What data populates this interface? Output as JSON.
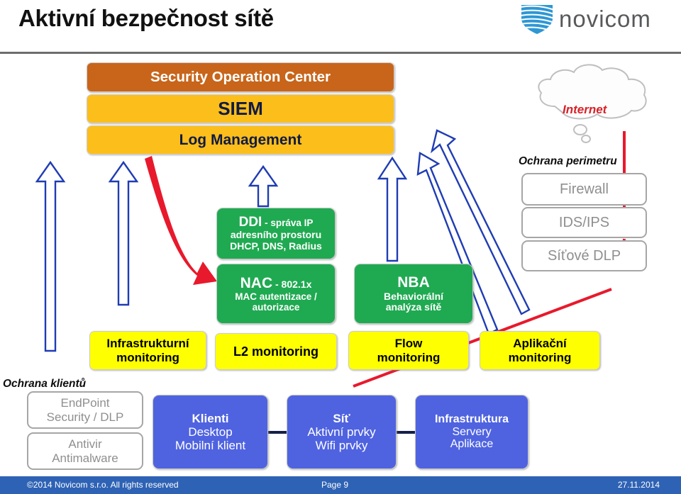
{
  "slide": {
    "title": "Aktivní bezpečnost sítě",
    "brand": {
      "wordmark": "novicom",
      "logo_icon": "shield-icon",
      "shield_color": "#2e97d4",
      "text_color": "#58595b"
    }
  },
  "colors": {
    "soc_header": "#c8651a",
    "soc_row": "#fcbe1a",
    "product_green": "#1faa51",
    "monitoring_yellow": "#feff00",
    "asset_blue": "#4f63e0",
    "third_party_box": "#ffffff",
    "third_party_text": "#8f8f8f",
    "flow_arrow_blue": "#1f3cb4",
    "threat_red": "#e8192c",
    "internet_text": "#d92128",
    "footer_bar": "#2e62b4"
  },
  "soc_stack": {
    "rows": [
      {
        "label": "Security Operation Center",
        "style": "orange"
      },
      {
        "label": "SIEM",
        "style": "gold"
      },
      {
        "label": "Log Management",
        "style": "gold"
      }
    ]
  },
  "products": [
    {
      "name": "ddi",
      "l1": "DDI",
      "l1_suffix": " - správa IP",
      "l2": "adresního prostoru",
      "l3": "DHCP, DNS, Radius"
    },
    {
      "name": "nac",
      "l1": "NAC",
      "l1_suffix": " - 802.1x",
      "l2": "MAC autentizace /",
      "l3": "autorizace"
    },
    {
      "name": "nba",
      "l1": "NBA",
      "l1_suffix": "",
      "l2": "Behaviorální",
      "l3": "analýza sítě"
    }
  ],
  "monitoring": [
    {
      "name": "infrastructure-monitoring",
      "l1": "Infrastrukturní",
      "l2": "monitoring"
    },
    {
      "name": "l2-monitoring",
      "l1": "L2 monitoring",
      "l2": ""
    },
    {
      "name": "flow-monitoring",
      "l1": "Flow",
      "l2": "monitoring"
    },
    {
      "name": "application-monitoring",
      "l1": "Aplikační",
      "l2": "monitoring"
    }
  ],
  "assets": [
    {
      "name": "clients",
      "l1": "Klienti",
      "l2": "Desktop",
      "l3": "Mobilní klient"
    },
    {
      "name": "network",
      "l1": "Síť",
      "l2": "Aktivní prvky",
      "l3": "Wifi prvky"
    },
    {
      "name": "infrastructure",
      "l1": "Infrastruktura",
      "l2": "Servery",
      "l3": "Aplikace"
    }
  ],
  "client_protection": {
    "label": "Ochrana klientů",
    "items": [
      {
        "name": "endpoint-security",
        "l1": "EndPoint",
        "l2": "Security / DLP"
      },
      {
        "name": "antivirus",
        "l1": "Antivir",
        "l2": "Antimalware"
      }
    ]
  },
  "perimeter_protection": {
    "label": "Ochrana perimetru",
    "internet_label": "Internet",
    "items": [
      {
        "name": "firewall",
        "l1": "Firewall"
      },
      {
        "name": "ids-ips",
        "l1": "IDS/IPS"
      },
      {
        "name": "network-dlp",
        "l1": "Síťové DLP"
      }
    ]
  },
  "footer": {
    "copyright": "©2014 Novicom s.r.o. All rights reserved",
    "page": "Page 9",
    "date": "27.11.2014"
  }
}
